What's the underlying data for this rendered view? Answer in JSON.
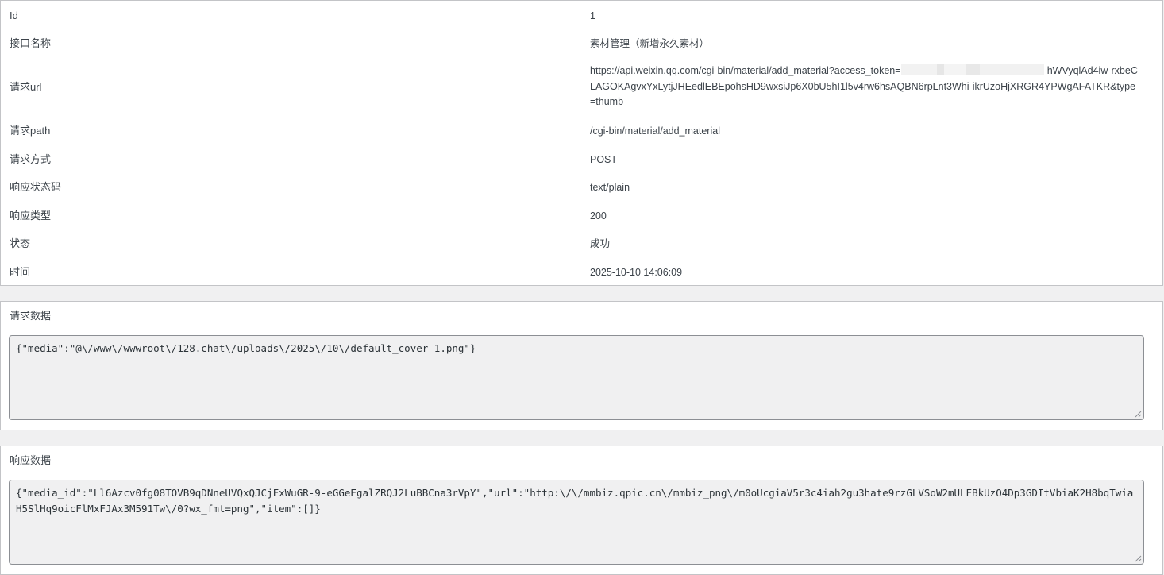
{
  "info": {
    "rows": [
      {
        "label": "Id",
        "value": "1"
      },
      {
        "label": "接口名称",
        "value": "素材管理（新增永久素材）"
      },
      {
        "label": "请求url",
        "value_before_mask": "https://api.weixin.qq.com/cgi-bin/material/add_material?access_token=",
        "value_after_mask": "-hWVyqlAd4iw-rxbeCLAGOKAgvxYxLytjJHEedlEBEpohsHD9wxsiJp6X0bU5hI1l5v4rw6hsAQBN6rpLnt3Whi-ikrUzoHjXRGR4YPWgAFATKR&type=thumb"
      },
      {
        "label": "请求path",
        "value": "/cgi-bin/material/add_material"
      },
      {
        "label": "请求方式",
        "value": "POST"
      },
      {
        "label": "响应状态码",
        "value": "text/plain"
      },
      {
        "label": "响应类型",
        "value": "200"
      },
      {
        "label": "状态",
        "value": "成功"
      },
      {
        "label": "时间",
        "value": "2025-10-10 14:06:09"
      }
    ]
  },
  "request": {
    "title": "请求数据",
    "body": "{\"media\":\"@\\/www\\/wwwroot\\/128.chat\\/uploads\\/2025\\/10\\/default_cover-1.png\"}"
  },
  "response": {
    "title": "响应数据",
    "body": "{\"media_id\":\"Ll6Azcv0fg08TOVB9qDNneUVQxQJCjFxWuGR-9-eGGeEgalZRQJ2LuBBCna3rVpY\",\"url\":\"http:\\/\\/mmbiz.qpic.cn\\/mmbiz_png\\/m0oUcgiaV5r3c4iah2gu3hate9rzGLVSoW2mULEBkUzO4Dp3GDItVbiaK2H8bqTwiaH5SlHq9oicFlMxFJAx3M591Tw\\/0?wx_fmt=png\",\"item\":[]}"
  }
}
